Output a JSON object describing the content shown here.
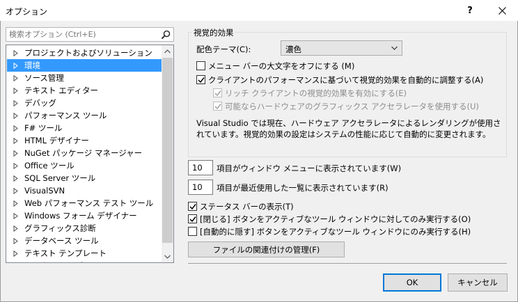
{
  "window": {
    "title": "オプション",
    "help": "?",
    "close": "✕"
  },
  "search": {
    "placeholder": "検索オプション (Ctrl+E)"
  },
  "tree": {
    "items": [
      {
        "label": "プロジェクトおよびソリューション"
      },
      {
        "label": "環境"
      },
      {
        "label": "ソース管理"
      },
      {
        "label": "テキスト エディター"
      },
      {
        "label": "デバッグ"
      },
      {
        "label": "パフォーマンス ツール"
      },
      {
        "label": "F# ツール"
      },
      {
        "label": "HTML デザイナー"
      },
      {
        "label": "NuGet パッケージ マネージャー"
      },
      {
        "label": "Office ツール"
      },
      {
        "label": "SQL Server ツール"
      },
      {
        "label": "VisualSVN"
      },
      {
        "label": "Web パフォーマンス テスト ツール"
      },
      {
        "label": "Windows フォーム デザイナー"
      },
      {
        "label": "グラフィックス診断"
      },
      {
        "label": "データベース ツール"
      },
      {
        "label": "テキスト テンプレート"
      },
      {
        "label": "ワークフロー デザイナー"
      }
    ],
    "selected_index": 1,
    "colors": {
      "selection": "#3399ff"
    }
  },
  "visual": {
    "group_title": "視覚的効果",
    "theme_label": "配色テーマ(C):",
    "theme_value": "濃色",
    "chk_uppercase": "メニュー バーの大文字をオフにする (M)",
    "chk_auto_adjust": "クライアントのパフォーマンスに基づいて視覚的効果を自動的に調整する(A)",
    "chk_rich": "リッチ クライアントの視覚的効果を有効にする(E)",
    "chk_hw": "可能ならハードウェアのグラフィックス アクセラレータを使用する(U)",
    "description": "Visual Studio では現在、ハードウェア アクセラレータによるレンダリングが使用されています。視覚的効果の設定はシステムの性能に応じて自動的に変更されます。"
  },
  "counts": {
    "window_menu_value": "10",
    "window_menu_label": "項目がウィンドウ メニューに表示されています(W)",
    "recent_value": "10",
    "recent_label": "項目が最近使用した一覧に表示されています(R)"
  },
  "options": {
    "status_bar": "ステータス バーの表示(T)",
    "close_active": "[閉じる] ボタンをアクティブなツール ウィンドウに対してのみ実行する(O)",
    "autohide_active": "[自動的に隠す] ボタンをアクティブなツール ウィンドウにのみ実行する(H)",
    "file_assoc": "ファイルの関連付けの管理(F)"
  },
  "footer": {
    "ok": "OK",
    "cancel": "キャンセル"
  }
}
